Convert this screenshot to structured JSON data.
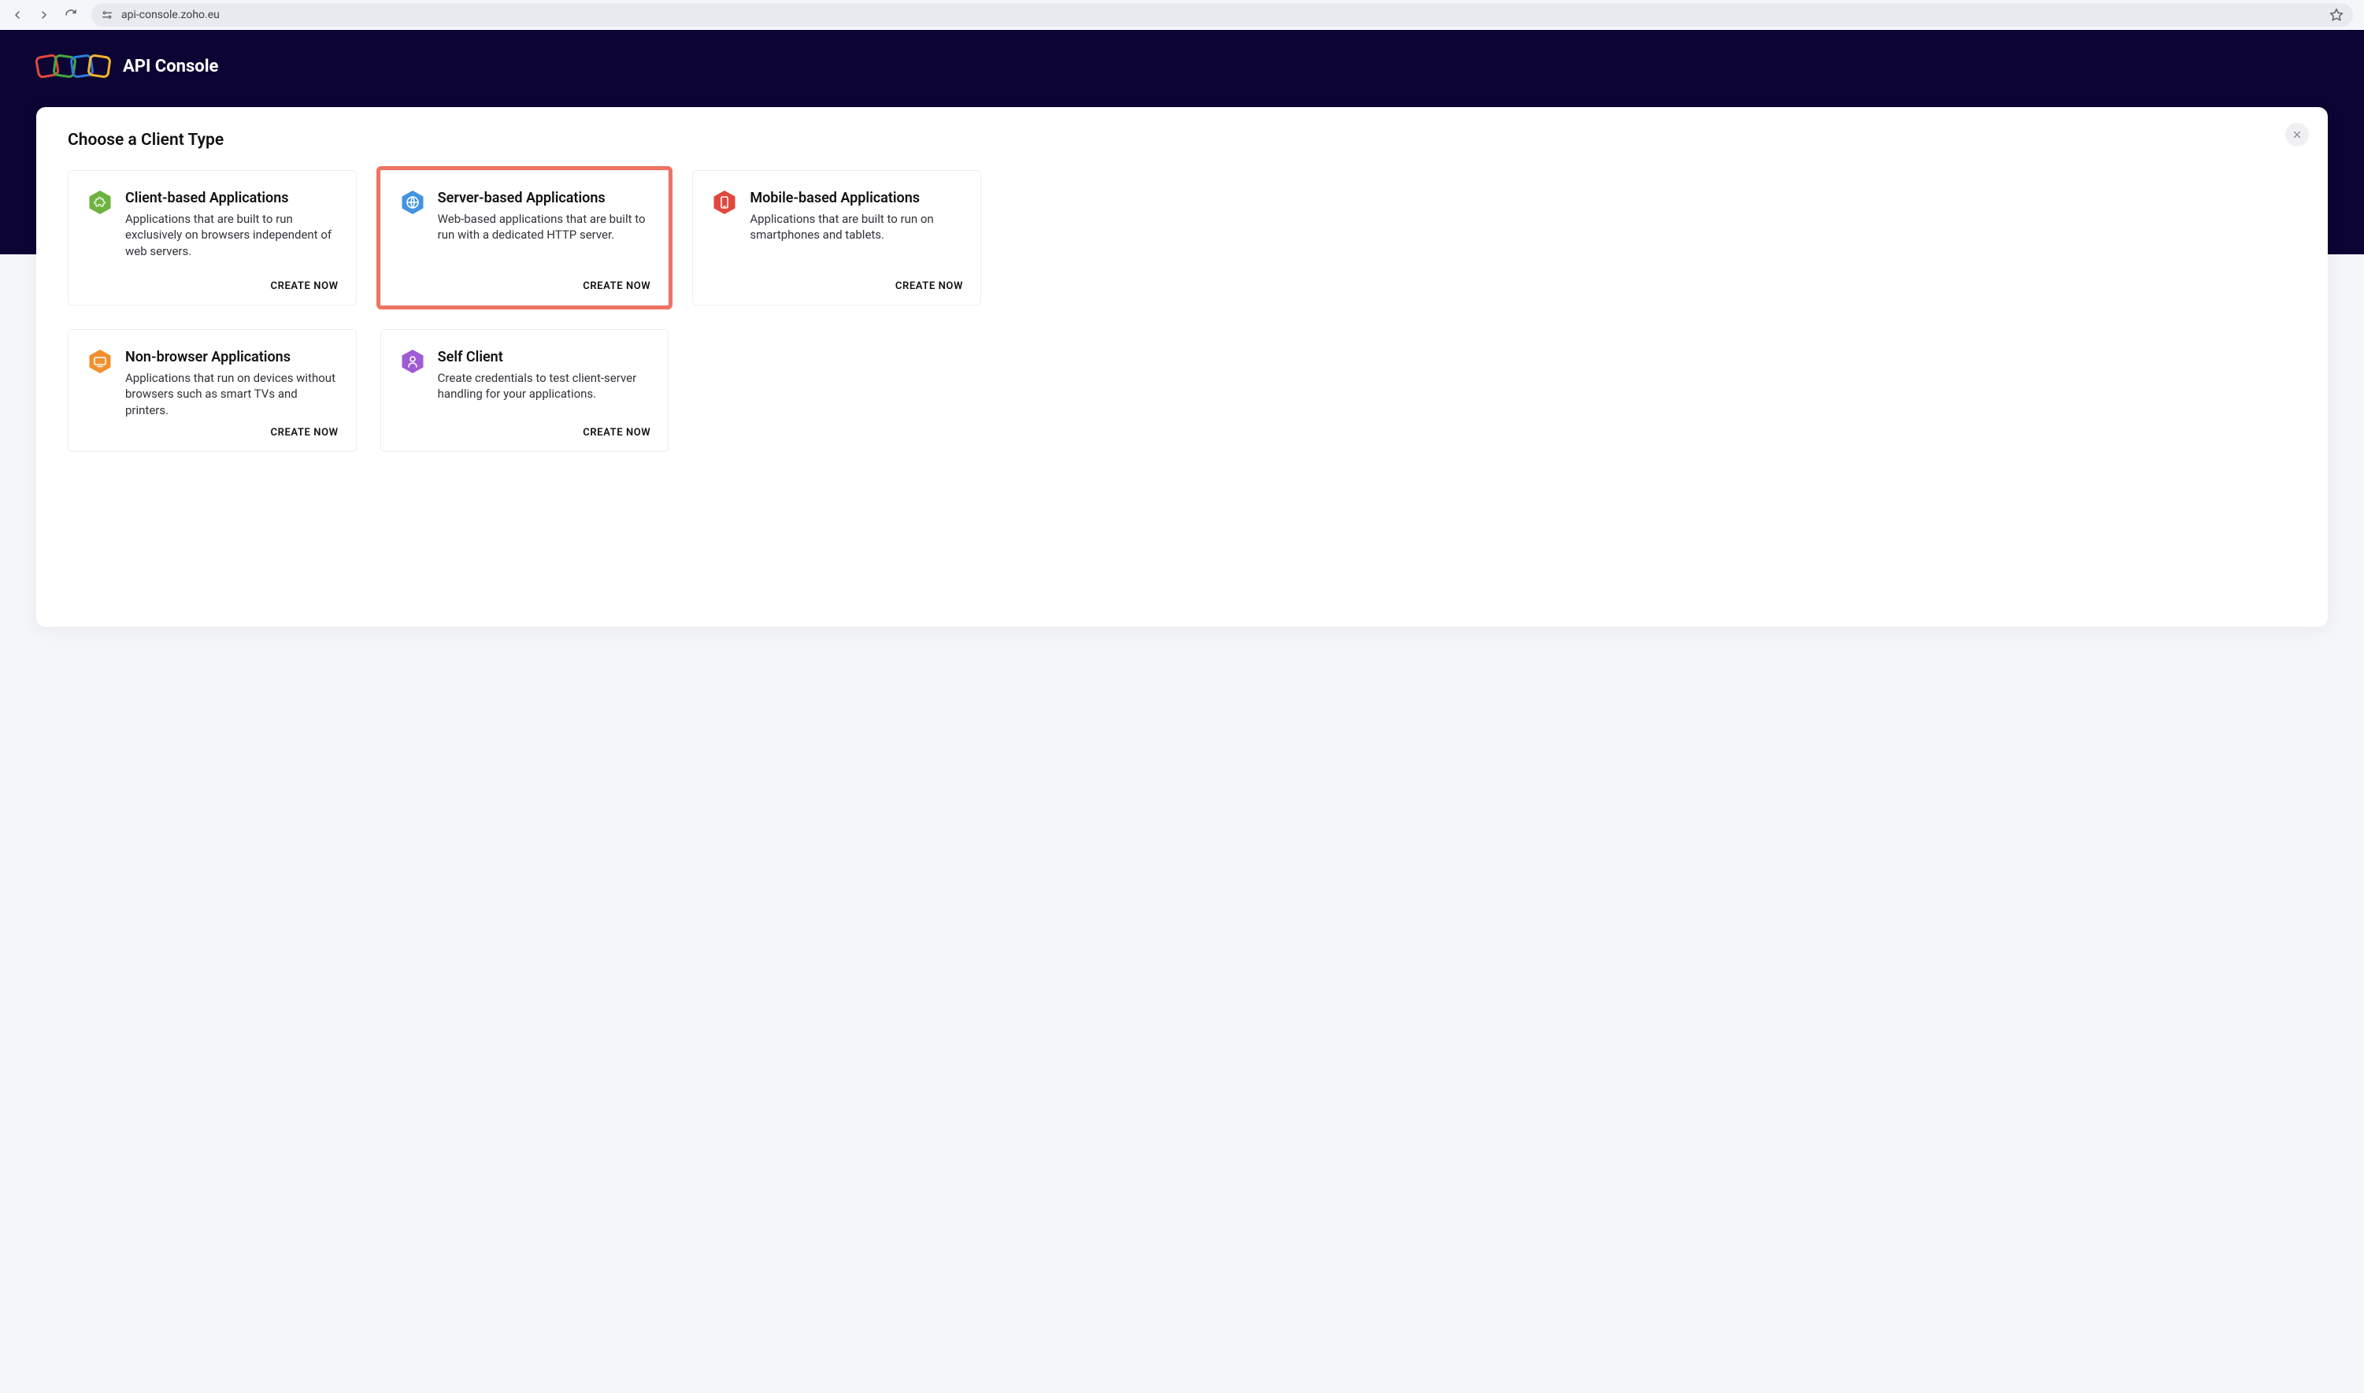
{
  "browser": {
    "url": "api-console.zoho.eu"
  },
  "brand": {
    "title": "API Console"
  },
  "page": {
    "heading": "Choose a Client Type",
    "create_label": "CREATE NOW"
  },
  "cards": [
    {
      "title": "Client-based Applications",
      "desc": "Applications that are built to run exclusively on browsers independent of web servers.",
      "color": "#6db33f",
      "icon": "puzzle",
      "highlight": false
    },
    {
      "title": "Server-based Applications",
      "desc": "Web-based applications that are built to run with a dedicated HTTP server.",
      "color": "#4293e1",
      "icon": "globe",
      "highlight": true
    },
    {
      "title": "Mobile-based Applications",
      "desc": "Applications that are built to run on smartphones and tablets.",
      "color": "#e0483e",
      "icon": "phone",
      "highlight": false
    },
    {
      "title": "Non-browser Applications",
      "desc": "Applications that run on devices without browsers such as smart TVs and printers.",
      "color": "#f0902e",
      "icon": "tv",
      "highlight": false
    },
    {
      "title": "Self Client",
      "desc": "Create credentials to test client-server handling for your applications.",
      "color": "#a05bd6",
      "icon": "person",
      "highlight": false
    }
  ]
}
